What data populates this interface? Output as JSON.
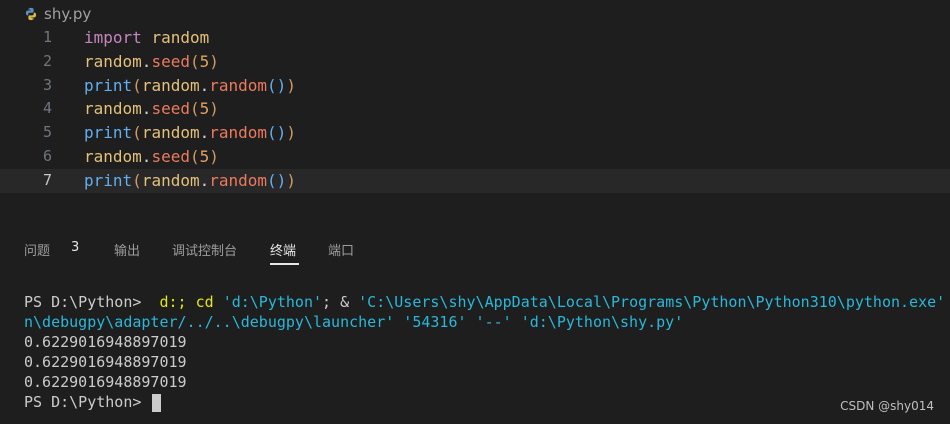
{
  "editor": {
    "tab_filename": "shy.py",
    "lines": [
      {
        "num": "1",
        "tokens": [
          {
            "t": "import",
            "c": "kw"
          },
          {
            "t": " ",
            "c": "dot"
          },
          {
            "t": "random",
            "c": "id"
          }
        ]
      },
      {
        "num": "2",
        "tokens": [
          {
            "t": "random",
            "c": "id"
          },
          {
            "t": ".",
            "c": "dot"
          },
          {
            "t": "seed",
            "c": "fn"
          },
          {
            "t": "(",
            "c": "pn"
          },
          {
            "t": "5",
            "c": "num"
          },
          {
            "t": ")",
            "c": "pn"
          }
        ]
      },
      {
        "num": "3",
        "tokens": [
          {
            "t": "print",
            "c": "bi"
          },
          {
            "t": "(",
            "c": "pn"
          },
          {
            "t": "random",
            "c": "id"
          },
          {
            "t": ".",
            "c": "dot"
          },
          {
            "t": "random",
            "c": "fn"
          },
          {
            "t": "()",
            "c": "bi"
          },
          {
            "t": ")",
            "c": "pn"
          }
        ]
      },
      {
        "num": "4",
        "tokens": [
          {
            "t": "random",
            "c": "id"
          },
          {
            "t": ".",
            "c": "dot"
          },
          {
            "t": "seed",
            "c": "fn"
          },
          {
            "t": "(",
            "c": "pn"
          },
          {
            "t": "5",
            "c": "num"
          },
          {
            "t": ")",
            "c": "pn"
          }
        ]
      },
      {
        "num": "5",
        "tokens": [
          {
            "t": "print",
            "c": "bi"
          },
          {
            "t": "(",
            "c": "pn"
          },
          {
            "t": "random",
            "c": "id"
          },
          {
            "t": ".",
            "c": "dot"
          },
          {
            "t": "random",
            "c": "fn"
          },
          {
            "t": "()",
            "c": "bi"
          },
          {
            "t": ")",
            "c": "pn"
          }
        ]
      },
      {
        "num": "6",
        "tokens": [
          {
            "t": "random",
            "c": "id"
          },
          {
            "t": ".",
            "c": "dot"
          },
          {
            "t": "seed",
            "c": "fn"
          },
          {
            "t": "(",
            "c": "pn"
          },
          {
            "t": "5",
            "c": "num"
          },
          {
            "t": ")",
            "c": "pn"
          }
        ]
      },
      {
        "num": "7",
        "tokens": [
          {
            "t": "print",
            "c": "bi"
          },
          {
            "t": "(",
            "c": "pn"
          },
          {
            "t": "random",
            "c": "id"
          },
          {
            "t": ".",
            "c": "dot"
          },
          {
            "t": "random",
            "c": "fn"
          },
          {
            "t": "()",
            "c": "bi"
          },
          {
            "t": ")",
            "c": "pn"
          }
        ]
      }
    ]
  },
  "panel": {
    "tabs": {
      "problems": "问题",
      "problems_count": "3",
      "output": "输出",
      "debug_console": "调试控制台",
      "terminal": "终端",
      "ports": "端口"
    }
  },
  "terminal": {
    "prompt": "PS D:\\Python> ",
    "cmd_part1": " d:; cd ",
    "cmd_path_quoted": "'d:\\Python'",
    "cmd_part2": "; & ",
    "cmd_exe_quoted": "'C:\\Users\\shy\\AppData\\Local\\Programs\\Python\\Python310\\python.exe'",
    "wrap_line": "n\\debugpy\\adapter/../..\\debugpy\\launcher' '54316' '--' 'd:\\Python\\shy.py'",
    "outputs": [
      "0.6229016948897019",
      "0.6229016948897019",
      "0.6229016948897019"
    ],
    "final_prompt": "PS D:\\Python> "
  },
  "watermark": "CSDN @shy014"
}
